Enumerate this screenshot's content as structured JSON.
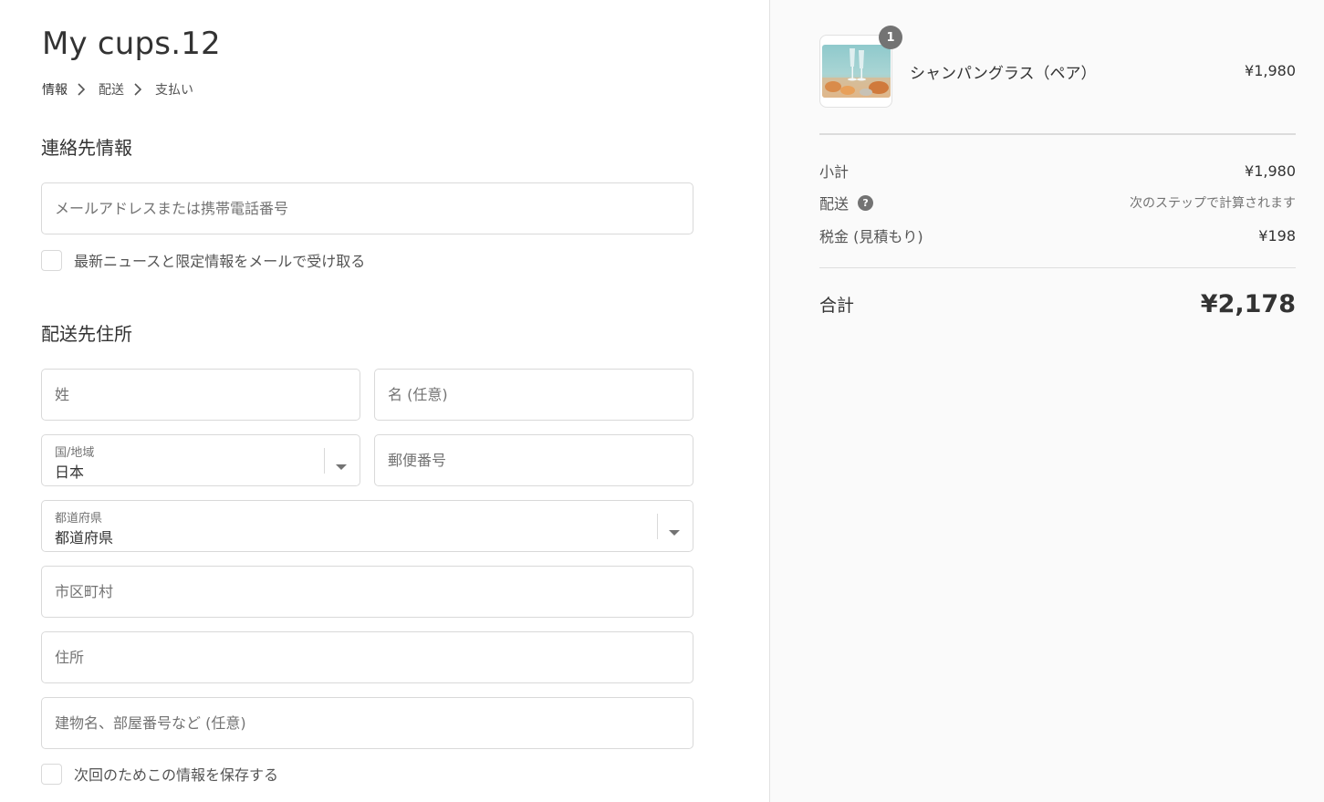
{
  "shop": {
    "title": "My cups.12"
  },
  "breadcrumb": {
    "items": [
      "情報",
      "配送",
      "支払い"
    ]
  },
  "contact": {
    "section_title": "連絡先情報",
    "email_placeholder": "メールアドレスまたは携帯電話番号",
    "newsletter_label": "最新ニュースと限定情報をメールで受け取る"
  },
  "shipping": {
    "section_title": "配送先住所",
    "last_name_placeholder": "姓",
    "first_name_placeholder": "名 (任意)",
    "country": {
      "label": "国/地域",
      "value": "日本"
    },
    "postal_placeholder": "郵便番号",
    "prefecture": {
      "label": "都道府県",
      "value": "都道府県"
    },
    "city_placeholder": "市区町村",
    "address_placeholder": "住所",
    "building_placeholder": "建物名、部屋番号など (任意)",
    "save_info_label": "次回のためこの情報を保存する"
  },
  "order": {
    "items": [
      {
        "name": "シャンパングラス（ペア）",
        "price": "¥1,980",
        "quantity": "1",
        "thumbnail_icon": "champagne-glass-product-image"
      }
    ],
    "subtotal_label": "小計",
    "subtotal_value": "¥1,980",
    "shipping_label": "配送",
    "shipping_value": "次のステップで計算されます",
    "tax_label": "税金 (見積もり)",
    "tax_value": "¥198",
    "total_label": "合計",
    "total_value": "¥2,178"
  },
  "colors": {
    "sidebar_bg": "#fafafa",
    "text": "#333333",
    "muted": "#737373",
    "border": "#d9d9d9"
  }
}
